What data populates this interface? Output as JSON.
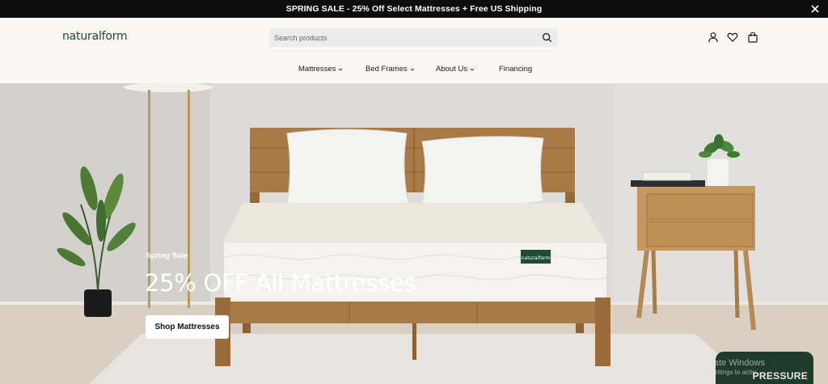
{
  "announcement": {
    "text": "SPRING SALE - 25% Off Select Mattresses + Free US Shipping"
  },
  "header": {
    "logo": "naturalform",
    "search": {
      "placeholder": "Search products",
      "value": ""
    },
    "icons": [
      "account-icon",
      "heart-icon",
      "bag-icon"
    ]
  },
  "nav": {
    "items": [
      {
        "label": "Mattresses",
        "has_dropdown": true
      },
      {
        "label": "Bed Frames",
        "has_dropdown": true
      },
      {
        "label": "About Us",
        "has_dropdown": true
      },
      {
        "label": "Financing",
        "has_dropdown": false
      }
    ]
  },
  "hero": {
    "eyebrow": "Spring Sale",
    "headline": "25% OFF All Mattresses",
    "cta": "Shop Mattresses",
    "mattress_label": "naturalform"
  },
  "badge": {
    "text": "PRESSURE"
  },
  "watermark": {
    "line1": "ate Windows",
    "line2": "ettings to activ"
  },
  "colors": {
    "brand": "#1f4a34",
    "announcement_bg": "#0d0d0d",
    "header_bg": "#fbf8f3",
    "badge_bg": "#1f3b2d"
  }
}
